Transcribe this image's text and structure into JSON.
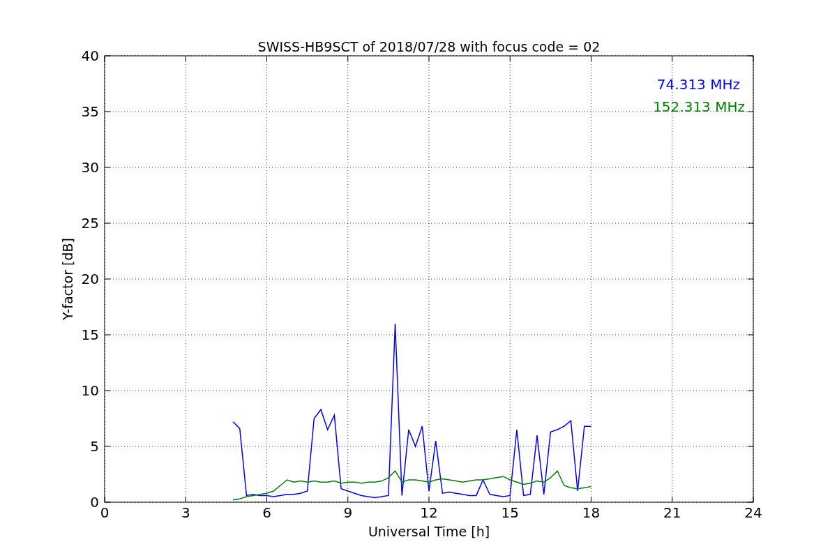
{
  "chart": {
    "chart_data": {
      "type": "line",
      "title": "SWISS-HB9SCT of 2018/07/28 with focus code = 02",
      "xlabel": "Universal Time [h]",
      "ylabel": "Y-factor [dB]",
      "xlim": [
        0,
        24
      ],
      "ylim": [
        0,
        40
      ],
      "xticks": [
        0,
        3,
        6,
        9,
        12,
        15,
        18,
        21,
        24
      ],
      "yticks": [
        0,
        5,
        10,
        15,
        20,
        25,
        30,
        35,
        40
      ],
      "grid": true,
      "x": [
        4.75,
        5.0,
        5.25,
        5.5,
        5.75,
        6.0,
        6.25,
        6.5,
        6.75,
        7.0,
        7.25,
        7.5,
        7.75,
        8.0,
        8.25,
        8.5,
        8.75,
        9.0,
        9.25,
        9.5,
        9.75,
        10.0,
        10.25,
        10.5,
        10.75,
        11.0,
        11.25,
        11.5,
        11.75,
        12.0,
        12.25,
        12.5,
        12.75,
        13.0,
        13.25,
        13.5,
        13.75,
        14.0,
        14.25,
        14.5,
        14.75,
        15.0,
        15.25,
        15.5,
        15.75,
        16.0,
        16.25,
        16.5,
        16.75,
        17.0,
        17.25,
        17.5,
        17.75,
        18.0
      ],
      "series": [
        {
          "name": "74.313 MHz",
          "color": "#0000ff",
          "values": [
            7.2,
            6.6,
            0.6,
            0.7,
            0.6,
            0.6,
            0.5,
            0.6,
            0.7,
            0.7,
            0.8,
            1.0,
            7.5,
            8.3,
            6.5,
            7.8,
            1.2,
            1.0,
            0.8,
            0.6,
            0.5,
            0.4,
            0.5,
            0.6,
            16.0,
            0.6,
            6.5,
            5.0,
            6.8,
            1.0,
            5.5,
            0.8,
            0.9,
            0.8,
            0.7,
            0.6,
            0.6,
            2.0,
            0.7,
            0.6,
            0.5,
            0.6,
            6.5,
            0.6,
            0.7,
            6.0,
            0.7,
            6.3,
            6.5,
            6.8,
            7.3,
            1.0,
            6.8,
            6.8
          ]
        },
        {
          "name": "152.313 MHz",
          "color": "#008000",
          "values": [
            0.2,
            0.3,
            0.5,
            0.6,
            0.7,
            0.8,
            1.0,
            1.5,
            2.0,
            1.8,
            1.9,
            1.8,
            1.9,
            1.8,
            1.8,
            1.9,
            1.7,
            1.8,
            1.8,
            1.7,
            1.8,
            1.8,
            1.9,
            2.2,
            2.8,
            1.8,
            2.0,
            2.0,
            1.9,
            1.8,
            2.0,
            2.1,
            2.0,
            1.9,
            1.8,
            1.9,
            2.0,
            2.0,
            2.1,
            2.2,
            2.3,
            2.0,
            1.8,
            1.6,
            1.7,
            1.9,
            1.8,
            2.2,
            2.8,
            1.5,
            1.3,
            1.2,
            1.3,
            1.4
          ]
        }
      ]
    }
  }
}
